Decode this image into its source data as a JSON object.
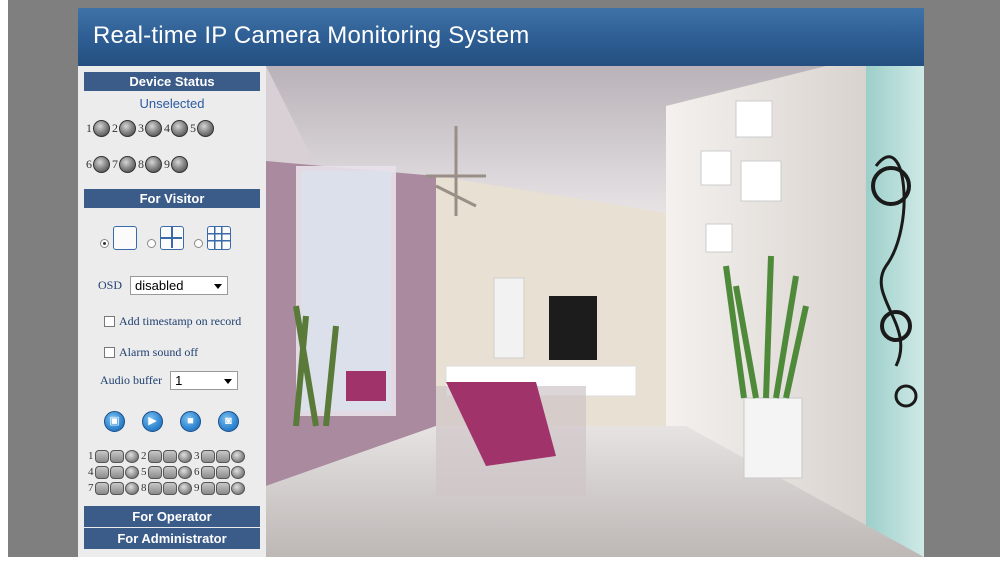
{
  "header": {
    "title": "Real-time IP Camera Monitoring System"
  },
  "sidebar": {
    "device_status": {
      "heading": "Device Status",
      "selection_text": "Unselected",
      "devices": [
        "1",
        "2",
        "3",
        "4",
        "5",
        "6",
        "7",
        "8",
        "9"
      ]
    },
    "visitor": {
      "heading": "For Visitor",
      "layout_options": [
        "1-view",
        "4-view",
        "9-view"
      ],
      "selected_layout": "1-view",
      "osd_label": "OSD",
      "osd_value": "disabled",
      "add_timestamp_label": "Add timestamp on record",
      "alarm_sound_off_label": "Alarm sound off",
      "audio_buffer_label": "Audio buffer",
      "audio_buffer_value": "1",
      "controls": [
        "record-icon",
        "play-icon",
        "stop-icon",
        "snapshot-icon"
      ],
      "camera_control_rows": [
        [
          "1",
          "2",
          "3"
        ],
        [
          "4",
          "5",
          "6"
        ],
        [
          "7",
          "8",
          "9"
        ]
      ]
    },
    "operator": {
      "heading": "For Operator"
    },
    "administrator": {
      "heading": "For Administrator"
    }
  },
  "video": {
    "description_icon": "camera-feed"
  },
  "colors": {
    "header": "#2d5d92",
    "section_head": "#3b5b89",
    "accent_text": "#2a5aa0",
    "frame_gray": "#7f7f7f"
  }
}
